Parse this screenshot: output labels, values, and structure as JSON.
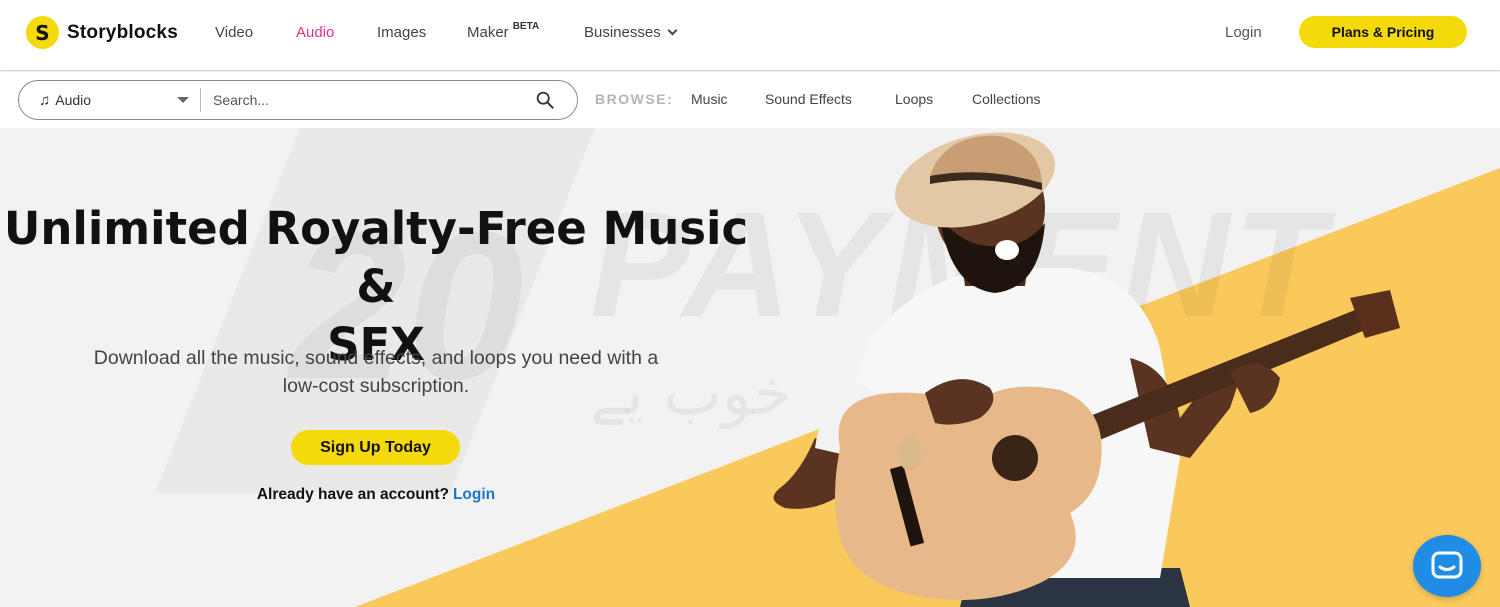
{
  "brand": {
    "name": "Storyblocks",
    "mark": "S",
    "accent": "#f4d90b",
    "active_nav_color": "#e6318c",
    "link_color": "#1a78c9"
  },
  "nav": {
    "video": "Video",
    "audio": "Audio",
    "images": "Images",
    "maker": "Maker",
    "maker_badge": "BETA",
    "businesses": "Businesses",
    "login": "Login",
    "plans": "Plans & Pricing"
  },
  "search": {
    "type_label": "Audio",
    "type_icon": "music-note-icon",
    "placeholder": "Search...",
    "value": ""
  },
  "browse": {
    "label": "BROWSE:",
    "links": [
      "Music",
      "Sound Effects",
      "Loops",
      "Collections"
    ]
  },
  "hero": {
    "title_line1": "Unlimited Royalty-Free Music &",
    "title_line2": "SFX",
    "subtitle_line1": "Download all the music, sound effects, and loops you need with a",
    "subtitle_line2": "low-cost subscription.",
    "cta": "Sign Up Today",
    "account_prompt": "Already have an account?",
    "account_login": "Login"
  },
  "watermark": {
    "number": "20",
    "word": "PAYMENT",
    "arabic": "خوب یے"
  },
  "chat": {
    "icon": "chat-bubble-icon"
  }
}
